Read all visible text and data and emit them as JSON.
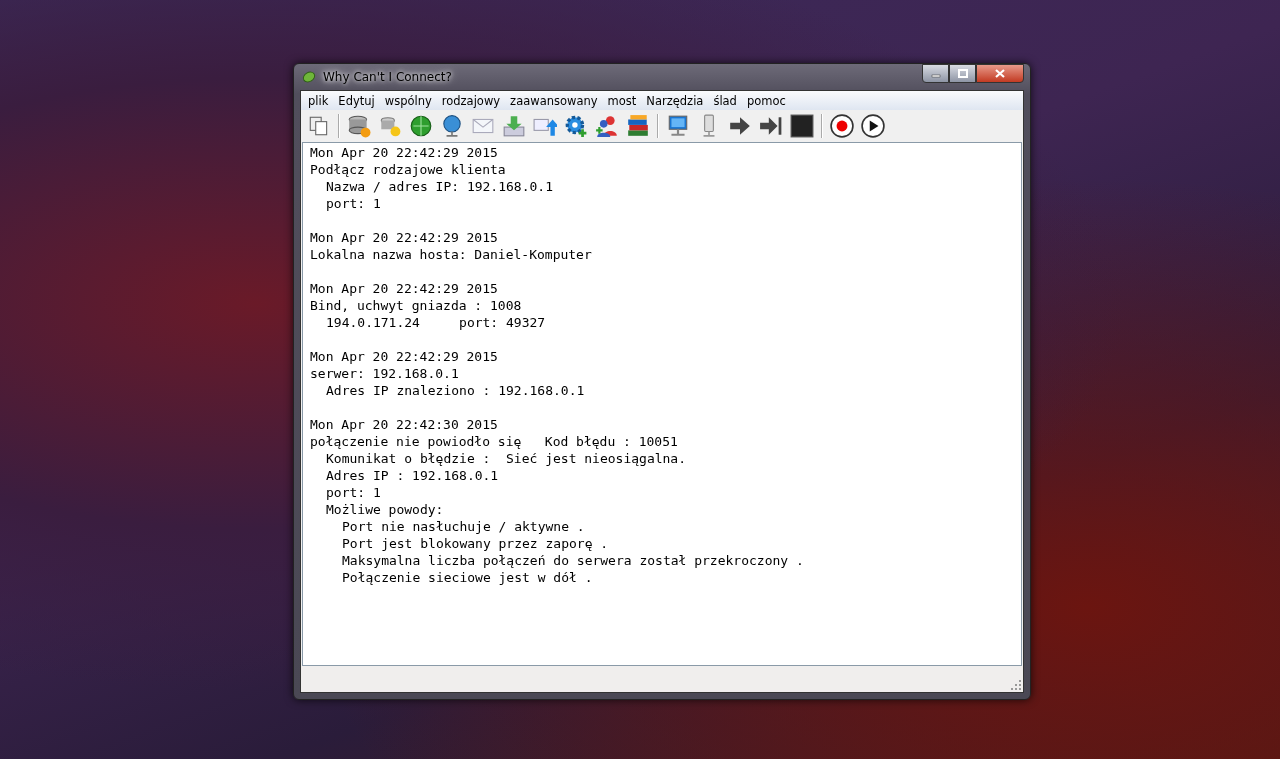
{
  "window": {
    "title": "Why Can't I Connect?"
  },
  "menu": [
    "plik",
    "Edytuj",
    "wspólny",
    "rodzajowy",
    "zaawansowany",
    "most",
    "Narzędzia",
    "ślad",
    "pomoc"
  ],
  "log": [
    {
      "time": "Mon Apr 20 22:42:29 2015",
      "lines": [
        {
          "text": "Podłącz rodzajowe klienta",
          "children": [
            {
              "text": "Nazwa / adres IP: 192.168.0.1"
            },
            {
              "text": "port: 1"
            }
          ]
        }
      ]
    },
    {
      "time": "Mon Apr 20 22:42:29 2015",
      "lines": [
        {
          "text": "Lokalna nazwa hosta: Daniel-Komputer"
        }
      ]
    },
    {
      "time": "Mon Apr 20 22:42:29 2015",
      "lines": [
        {
          "text": "Bind, uchwyt gniazda : 1008",
          "children": [
            {
              "text": "194.0.171.24     port: 49327"
            }
          ]
        }
      ]
    },
    {
      "time": "Mon Apr 20 22:42:29 2015",
      "lines": [
        {
          "text": "serwer: 192.168.0.1",
          "children": [
            {
              "text": "Adres IP znaleziono : 192.168.0.1"
            }
          ]
        }
      ]
    },
    {
      "time": "Mon Apr 20 22:42:30 2015",
      "lines": [
        {
          "text": "połączenie nie powiodło się   Kod błędu : 10051",
          "children": [
            {
              "text": "Komunikat o błędzie :  Sieć jest nieosiągalna."
            },
            {
              "text": "Adres IP : 192.168.0.1"
            },
            {
              "text": "port: 1"
            },
            {
              "text": "Możliwe powody:",
              "children": [
                {
                  "text": "Port nie nasłuchuje / aktywne ."
                },
                {
                  "text": "Port jest blokowany przez zaporę ."
                },
                {
                  "text": "Maksymalna liczba połączeń do serwera został przekroczony ."
                },
                {
                  "text": "Połączenie sieciowe jest w dół ."
                }
              ]
            }
          ]
        }
      ]
    }
  ]
}
